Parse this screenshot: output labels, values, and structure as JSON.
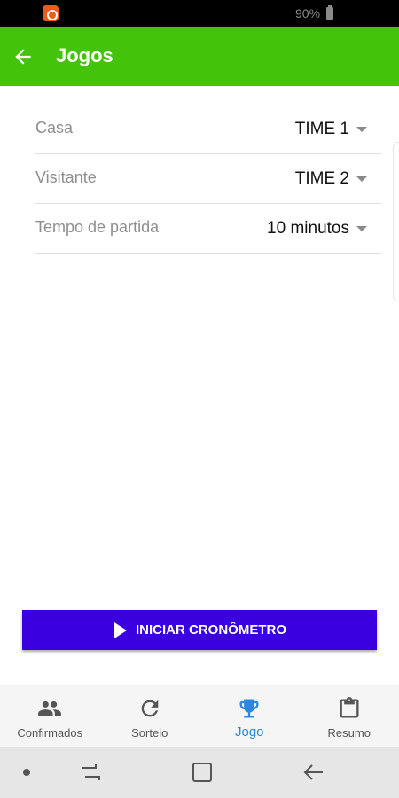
{
  "status_bar": {
    "battery": "90%",
    "app_icon": "notification-app-icon",
    "battery_icon": "battery-icon"
  },
  "app_bar": {
    "title": "Jogos",
    "back_icon": "arrow-back-icon",
    "color": "#43c30a"
  },
  "form": {
    "rows": [
      {
        "label": "Casa",
        "value": "TIME 1"
      },
      {
        "label": "Visitante",
        "value": "TIME 2"
      },
      {
        "label": "Tempo de partida",
        "value": "10 minutos"
      }
    ]
  },
  "start_button": {
    "label": "INICIAR CRONÔMETRO",
    "icon": "play-icon",
    "color": "#3b00e0"
  },
  "bottom_nav": {
    "items": [
      {
        "label": "Confirmados",
        "icon": "people-icon"
      },
      {
        "label": "Sorteio",
        "icon": "refresh-icon"
      },
      {
        "label": "Jogo",
        "icon": "trophy-icon",
        "active": true
      },
      {
        "label": "Resumo",
        "icon": "clipboard-icon"
      }
    ],
    "active_color": "#2b86e4"
  }
}
